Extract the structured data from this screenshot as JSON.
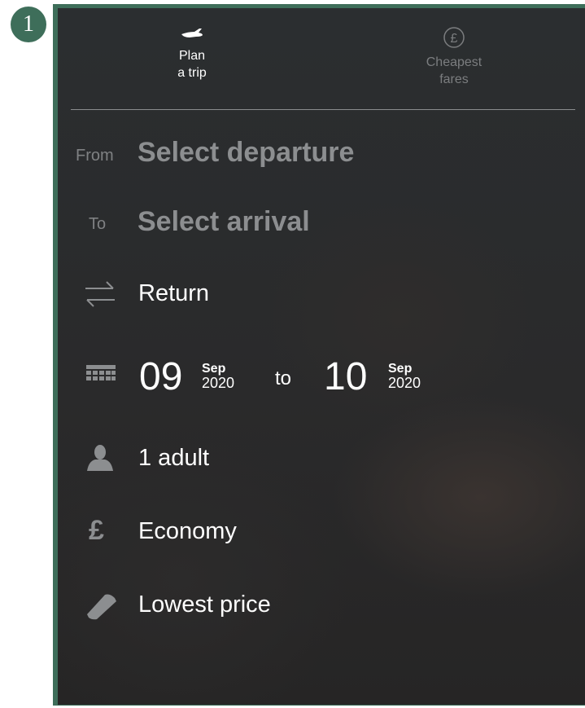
{
  "annotation": {
    "number": "1"
  },
  "tabs": [
    {
      "line1": "Plan",
      "line2": "a trip",
      "icon": "plane-icon",
      "active": true
    },
    {
      "line1": "Cheapest",
      "line2": "fares",
      "icon": "pound-circle-icon",
      "active": false
    }
  ],
  "from": {
    "label": "From",
    "placeholder": "Select departure"
  },
  "to": {
    "label": "To",
    "placeholder": "Select arrival"
  },
  "trip_type": {
    "icon": "swap-arrows-icon",
    "value": "Return"
  },
  "dates": {
    "icon": "calendar-icon",
    "start": {
      "day": "09",
      "month": "Sep",
      "year": "2020"
    },
    "separator": "to",
    "end": {
      "day": "10",
      "month": "Sep",
      "year": "2020"
    }
  },
  "passengers": {
    "icon": "person-icon",
    "value": "1 adult"
  },
  "cabin": {
    "icon": "pound-icon",
    "value": "Economy"
  },
  "sort": {
    "icon": "ticket-icon",
    "value": "Lowest price"
  },
  "colors": {
    "frame": "#3e6e5a",
    "panel": "#2a2b2c",
    "active_text": "#ffffff",
    "muted_text": "#7b7d7f"
  }
}
